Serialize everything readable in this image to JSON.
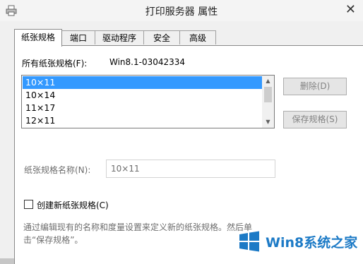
{
  "window": {
    "title": "打印服务器 属性",
    "close_glyph": "✕"
  },
  "tabs": [
    {
      "label": "纸张规格",
      "active": true
    },
    {
      "label": "端口",
      "active": false
    },
    {
      "label": "驱动程序",
      "active": false
    },
    {
      "label": "安全",
      "active": false
    },
    {
      "label": "高级",
      "active": false
    }
  ],
  "forms": {
    "all_forms_label": "所有纸张规格(F):",
    "server_name": "Win8.1-03042334",
    "items": [
      "10×11",
      "10×14",
      "11×17",
      "12×11"
    ],
    "selected_index": 0,
    "delete_button": "删除(D)",
    "save_button": "保存规格(S)",
    "form_name_label": "纸张规格名称(N):",
    "form_name_value": "10×11",
    "create_checkbox_label": "创建新纸张规格(C)",
    "create_checked": false,
    "description": "通过编辑现有的名称和度量设置来定义新的纸张规格。然后单击“保存规格”。"
  },
  "watermark": {
    "text": "Win8系统之家"
  },
  "colors": {
    "selection": "#3399ff",
    "disabled_text": "#838383",
    "watermark_blue": "#1c7ac6"
  }
}
